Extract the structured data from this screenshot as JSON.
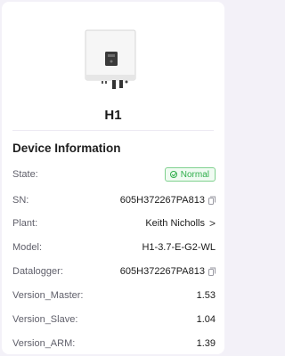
{
  "device": {
    "name": "H1"
  },
  "section": {
    "title": "Device Information"
  },
  "info": {
    "state": {
      "label": "State:",
      "value": "Normal"
    },
    "sn": {
      "label": "SN:",
      "value": "605H372267PA813"
    },
    "plant": {
      "label": "Plant:",
      "value": "Keith Nicholls"
    },
    "model": {
      "label": "Model:",
      "value": "H1-3.7-E-G2-WL"
    },
    "datalogger": {
      "label": "Datalogger:",
      "value": "605H372267PA813"
    },
    "version_master": {
      "label": "Version_Master:",
      "value": "1.53"
    },
    "version_slave": {
      "label": "Version_Slave:",
      "value": "1.04"
    },
    "version_arm": {
      "label": "Version_ARM:",
      "value": "1.39"
    }
  },
  "colors": {
    "status_normal": "#2fae4a",
    "background": "#f3f1f8"
  },
  "icons": {
    "state": "check-circle-icon",
    "copy": "copy-icon",
    "chevron": "chevron-right-icon"
  }
}
